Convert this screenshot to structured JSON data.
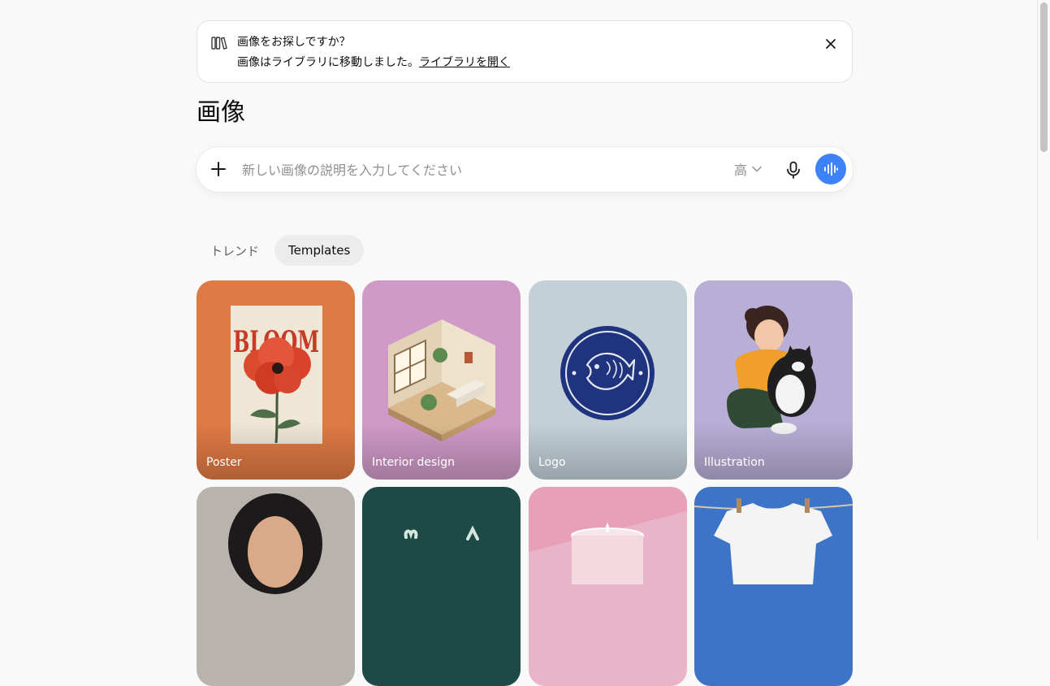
{
  "banner": {
    "title": "画像をお探しですか？",
    "message": "画像はライブラリに移動しました。",
    "link": "ライブラリを開く"
  },
  "page_title": "画像",
  "composer": {
    "placeholder": "新しい画像の説明を入力してください",
    "quality": "高"
  },
  "tabs": [
    {
      "label": "トレンド",
      "active": false
    },
    {
      "label": "Templates",
      "active": true
    }
  ],
  "cards": [
    {
      "label": "Poster",
      "color": "#e07a45",
      "poster_text": "BLOOM"
    },
    {
      "label": "Interior design",
      "color": "#cf9ac8"
    },
    {
      "label": "Logo",
      "color": "#c3d0d8"
    },
    {
      "label": "Illustration",
      "color": "#b8aed6"
    },
    {
      "label": "",
      "color": "#b8b3ad"
    },
    {
      "label": "",
      "color": "#1e4a45"
    },
    {
      "label": "",
      "color": "#eab4c8"
    },
    {
      "label": "",
      "color": "#3e74c8"
    }
  ],
  "colors": {
    "accent": "#3d82f6",
    "background": "#f9f9f9"
  }
}
